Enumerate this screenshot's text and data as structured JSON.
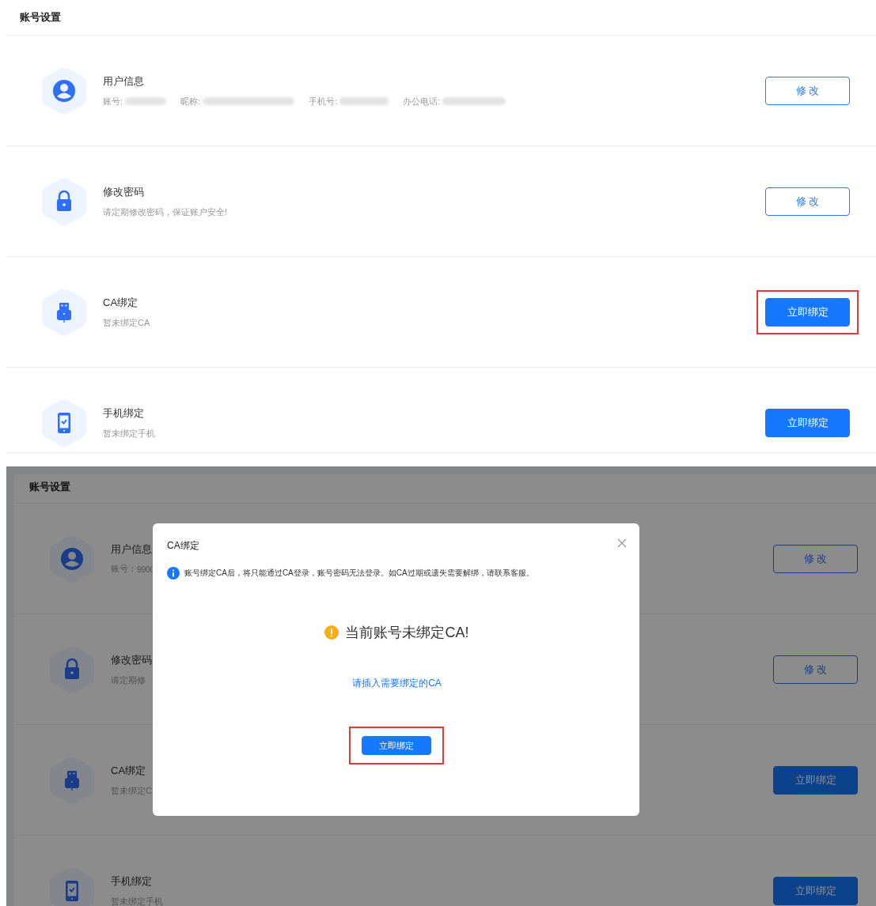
{
  "screens": [
    {
      "kind": "page",
      "header": "账号设置",
      "rows": [
        {
          "kind": "profile",
          "title": "用户信息",
          "fields": [
            {
              "label": "账号:",
              "redacted": true
            },
            {
              "label": "昵称:",
              "redacted": true
            },
            {
              "label": "手机号:",
              "redacted": true
            },
            {
              "label": "办公电话:",
              "redacted": true
            }
          ],
          "button": {
            "label": "修 改",
            "highlighted": false
          }
        },
        {
          "kind": "password",
          "title": "修改密码",
          "description": "请定期修改密码，保证账户安全!",
          "button": {
            "label": "修 改",
            "highlighted": false
          }
        },
        {
          "kind": "ca",
          "title": "CA绑定",
          "description": "暂未绑定CA",
          "button": {
            "label": "立即绑定",
            "highlighted": true
          }
        },
        {
          "kind": "phone",
          "title": "手机绑定",
          "description": "暂未绑定手机",
          "button": {
            "label": "立即绑定",
            "highlighted": false
          }
        }
      ]
    },
    {
      "kind": "dialog_open",
      "header": "账号设置",
      "rows": [
        {
          "kind": "profile",
          "title": "用户信息",
          "fields": [
            {
              "label": "账号：",
              "value": "9900"
            }
          ],
          "button": {
            "label": "修 改",
            "highlighted": false
          }
        },
        {
          "kind": "password",
          "title": "修改密码",
          "description": "请定期修",
          "button": {
            "label": "修 改",
            "highlighted": false
          }
        },
        {
          "kind": "ca",
          "title": "CA绑定",
          "description": "暂未绑定C",
          "button": {
            "label": "立即绑定",
            "highlighted": false
          }
        },
        {
          "kind": "phone",
          "title": "手机绑定",
          "description": "暂未绑定手机",
          "button": {
            "label": "立即绑定",
            "highlighted": false
          }
        }
      ],
      "dialog": {
        "title": "CA绑定",
        "notice": "账号绑定CA后，将只能通过CA登录，账号密码无法登录。如CA过期或遗失需要解绑，请联系客服。",
        "warning": "当前账号未绑定CA!",
        "link": "请插入需要绑定的CA",
        "button": {
          "label": "立即绑定",
          "highlighted": true
        }
      }
    }
  ]
}
